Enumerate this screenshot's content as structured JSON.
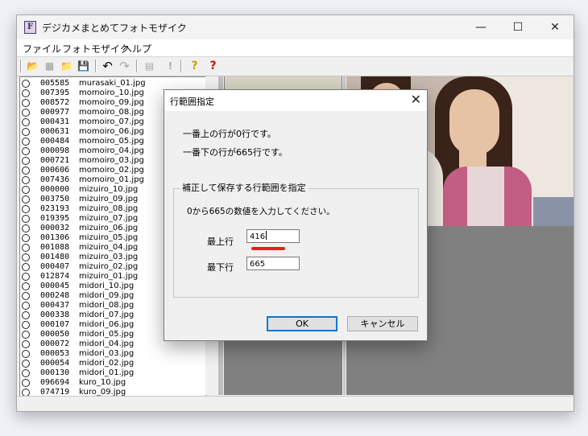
{
  "window": {
    "title": "デジカメまとめてフォトモザイク",
    "app_icon_letter": "F",
    "minimize": "—",
    "maximize": "☐",
    "close": "✕"
  },
  "menu": {
    "file": "ファイル",
    "mosaic": "フォトモザイク",
    "help": "ヘルプ"
  },
  "toolbar": {
    "open": "📂",
    "open_db": "▦",
    "folder": "📁",
    "save": "💾",
    "undo": "↶",
    "redo": "↷",
    "list": "▤",
    "exclaim": "!",
    "help": "?",
    "help2": "?"
  },
  "file_list": [
    {
      "num": "005585",
      "name": "murasaki_01.jpg"
    },
    {
      "num": "007395",
      "name": "momoiro_10.jpg"
    },
    {
      "num": "008572",
      "name": "momoiro_09.jpg"
    },
    {
      "num": "000977",
      "name": "momoiro_08.jpg"
    },
    {
      "num": "000431",
      "name": "momoiro_07.jpg"
    },
    {
      "num": "000631",
      "name": "momoiro_06.jpg"
    },
    {
      "num": "000484",
      "name": "momoiro_05.jpg"
    },
    {
      "num": "000098",
      "name": "momoiro_04.jpg"
    },
    {
      "num": "000721",
      "name": "momoiro_03.jpg"
    },
    {
      "num": "000606",
      "name": "momoiro_02.jpg"
    },
    {
      "num": "007436",
      "name": "momoiro_01.jpg"
    },
    {
      "num": "000000",
      "name": "mizuiro_10.jpg"
    },
    {
      "num": "003750",
      "name": "mizuiro_09.jpg"
    },
    {
      "num": "023193",
      "name": "mizuiro_08.jpg"
    },
    {
      "num": "019395",
      "name": "mizuiro_07.jpg"
    },
    {
      "num": "000032",
      "name": "mizuiro_06.jpg"
    },
    {
      "num": "001306",
      "name": "mizuiro_05.jpg"
    },
    {
      "num": "001088",
      "name": "mizuiro_04.jpg"
    },
    {
      "num": "001480",
      "name": "mizuiro_03.jpg"
    },
    {
      "num": "000407",
      "name": "mizuiro_02.jpg"
    },
    {
      "num": "012874",
      "name": "mizuiro_01.jpg"
    },
    {
      "num": "000045",
      "name": "midori_10.jpg"
    },
    {
      "num": "000248",
      "name": "midori_09.jpg"
    },
    {
      "num": "000437",
      "name": "midori_08.jpg"
    },
    {
      "num": "000338",
      "name": "midori_07.jpg"
    },
    {
      "num": "000107",
      "name": "midori_06.jpg"
    },
    {
      "num": "000050",
      "name": "midori_05.jpg"
    },
    {
      "num": "000072",
      "name": "midori_04.jpg"
    },
    {
      "num": "000053",
      "name": "midori_03.jpg"
    },
    {
      "num": "000054",
      "name": "midori_02.jpg"
    },
    {
      "num": "000130",
      "name": "midori_01.jpg"
    },
    {
      "num": "096694",
      "name": "kuro_10.jpg"
    },
    {
      "num": "074719",
      "name": "kuro_09.jpg"
    }
  ],
  "dialog": {
    "title": "行範囲指定",
    "close": "✕",
    "info_top": "一番上の行が0行です。",
    "info_bottom": "一番下の行が665行です。",
    "group_label": "補正して保存する行範囲を指定",
    "hint": "0から665の数値を入力してください。",
    "top_label": "最上行",
    "top_value": "416",
    "bottom_label": "最下行",
    "bottom_value": "665",
    "ok": "OK",
    "cancel": "キャンセル"
  },
  "colors": {
    "accent": "#0078d7",
    "marker": "#ee1c1c",
    "panel": "#808080"
  }
}
